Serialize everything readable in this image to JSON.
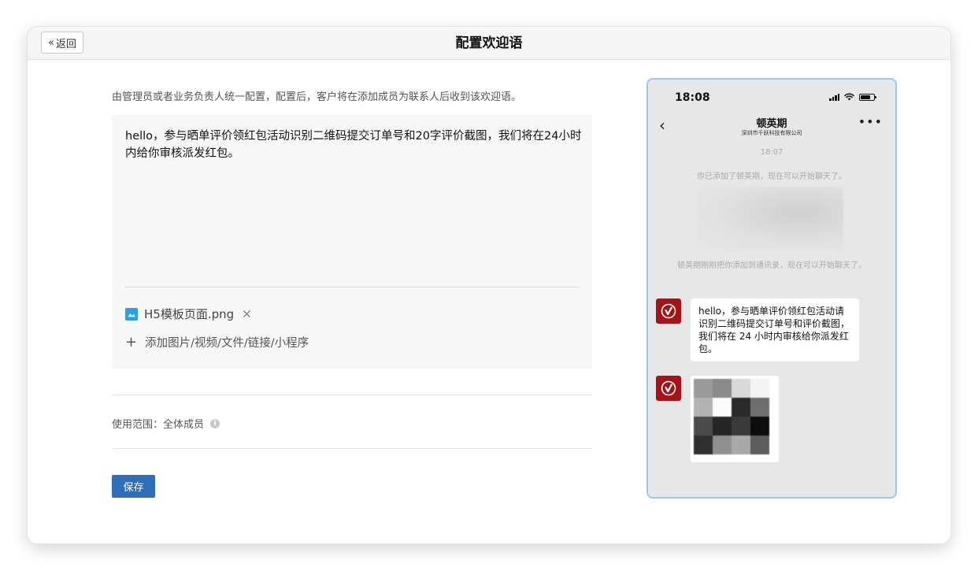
{
  "header": {
    "back_label": "返回",
    "title": "配置欢迎语"
  },
  "form": {
    "description": "由管理员或者业务负责人统一配置，配置后，客户将在添加成员为联系人后收到该欢迎语。",
    "message_text": "hello，参与晒单评价领红包活动识别二维码提交订单号和20字评价截图，我们将在24小时内给你审核派发红包。",
    "attachment_name": "H5模板页面.png",
    "add_attachment_label": "添加图片/视频/文件/链接/小程序",
    "scope_label": "使用范围：全体成员",
    "save_label": "保存"
  },
  "preview": {
    "time": "18:08",
    "contact_name": "顿英期",
    "company": "深圳市千跃科技有限公司",
    "message_time": "18:07",
    "system_msg_added": "你已添加了顿英期，现在可以开始聊天了。",
    "system_msg_contacts": "顿英期刚刚把你添加到通讯录，现在可以开始聊天了。",
    "bubble_text": "hello，参与晒单评价领红包活动请识别二维码提交订单号和评价截图，我们将在 24 小时内审核给你派发红包。"
  },
  "colors": {
    "primary": "#2f6fb8",
    "avatar": "#a3141a",
    "phone_border": "#9fc7ea",
    "file_icon": "#2e9fd8"
  }
}
